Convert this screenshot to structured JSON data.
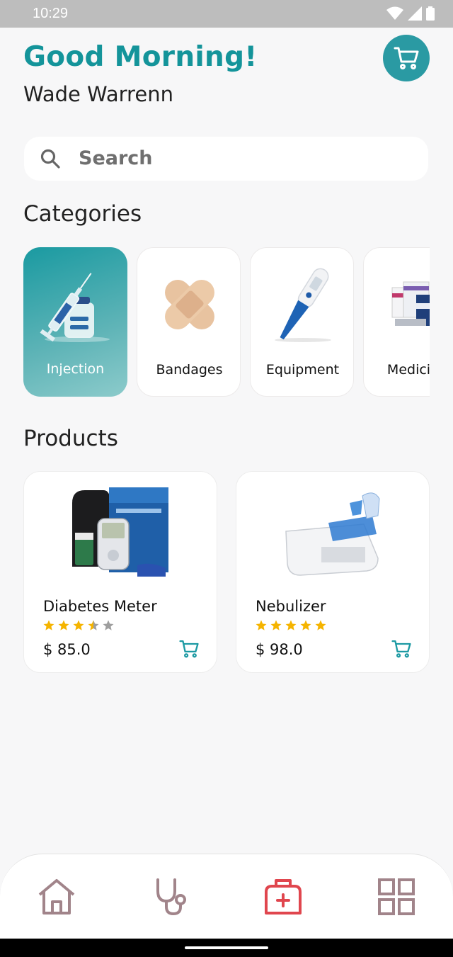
{
  "status_bar": {
    "time": "10:29"
  },
  "header": {
    "greeting": "Good Morning!",
    "user_name": "Wade Warrenn"
  },
  "search": {
    "placeholder": "Search",
    "value": ""
  },
  "categories": {
    "title": "Categories",
    "items": [
      {
        "label": "Injection",
        "icon": "syringe-icon",
        "active": true
      },
      {
        "label": "Bandages",
        "icon": "bandage-icon",
        "active": false
      },
      {
        "label": "Equipment",
        "icon": "thermometer-icon",
        "active": false
      },
      {
        "label": "Medici",
        "icon": "medicine-boxes-icon",
        "active": false
      }
    ]
  },
  "products": {
    "title": "Products",
    "items": [
      {
        "name": "Diabetes Meter",
        "rating": 3.5,
        "price": "$ 85.0",
        "image": "glucose-meter-kit-image"
      },
      {
        "name": "Nebulizer",
        "rating": 5,
        "price": "$ 98.0",
        "image": "nebulizer-image"
      }
    ]
  },
  "bottom_nav": {
    "items": [
      {
        "icon": "home-icon",
        "active": false
      },
      {
        "icon": "stethoscope-icon",
        "active": false
      },
      {
        "icon": "medical-kit-icon",
        "active": true
      },
      {
        "icon": "grid-icon",
        "active": false
      }
    ]
  },
  "colors": {
    "accent": "#14949a",
    "active_nav": "#e0464e",
    "inactive_nav": "#a1848a",
    "star": "#f5b400"
  }
}
